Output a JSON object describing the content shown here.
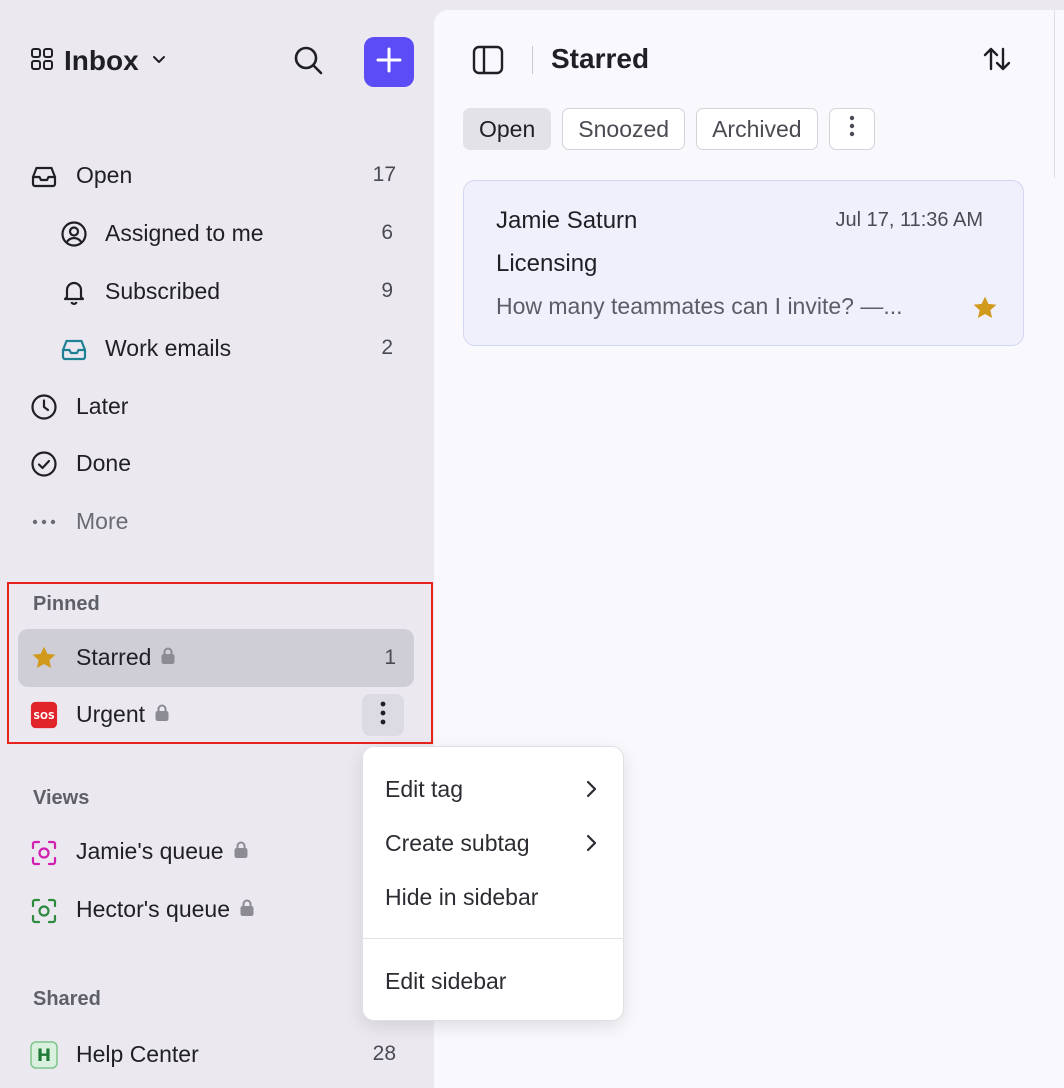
{
  "sidebar": {
    "header": {
      "title": "Inbox"
    },
    "nav": [
      {
        "label": "Open",
        "count": "17"
      },
      {
        "label": "Assigned to me",
        "count": "6"
      },
      {
        "label": "Subscribed",
        "count": "9"
      },
      {
        "label": "Work emails",
        "count": "2"
      },
      {
        "label": "Later"
      },
      {
        "label": "Done"
      },
      {
        "label": "More"
      }
    ],
    "pinned": {
      "title": "Pinned",
      "items": [
        {
          "label": "Starred",
          "count": "1"
        },
        {
          "label": "Urgent"
        }
      ]
    },
    "views": {
      "title": "Views",
      "items": [
        {
          "label": "Jamie's queue"
        },
        {
          "label": "Hector's queue"
        }
      ]
    },
    "shared": {
      "title": "Shared",
      "items": [
        {
          "label": "Help Center",
          "count": "28",
          "badge": "H"
        }
      ]
    }
  },
  "main": {
    "title": "Starred",
    "tabs": [
      "Open",
      "Snoozed",
      "Archived"
    ],
    "conversations": [
      {
        "sender": "Jamie Saturn",
        "time": "Jul 17, 11:36 AM",
        "subject": "Licensing",
        "preview": "How many teammates can I invite? —..."
      }
    ]
  },
  "context_menu": {
    "items": [
      "Edit tag",
      "Create subtag",
      "Hide in sidebar",
      "Edit sidebar"
    ]
  },
  "colors": {
    "accent": "#5b4cf5",
    "star": "#d19a1c",
    "highlight": "#e8231d",
    "sos": "#e0242a"
  }
}
